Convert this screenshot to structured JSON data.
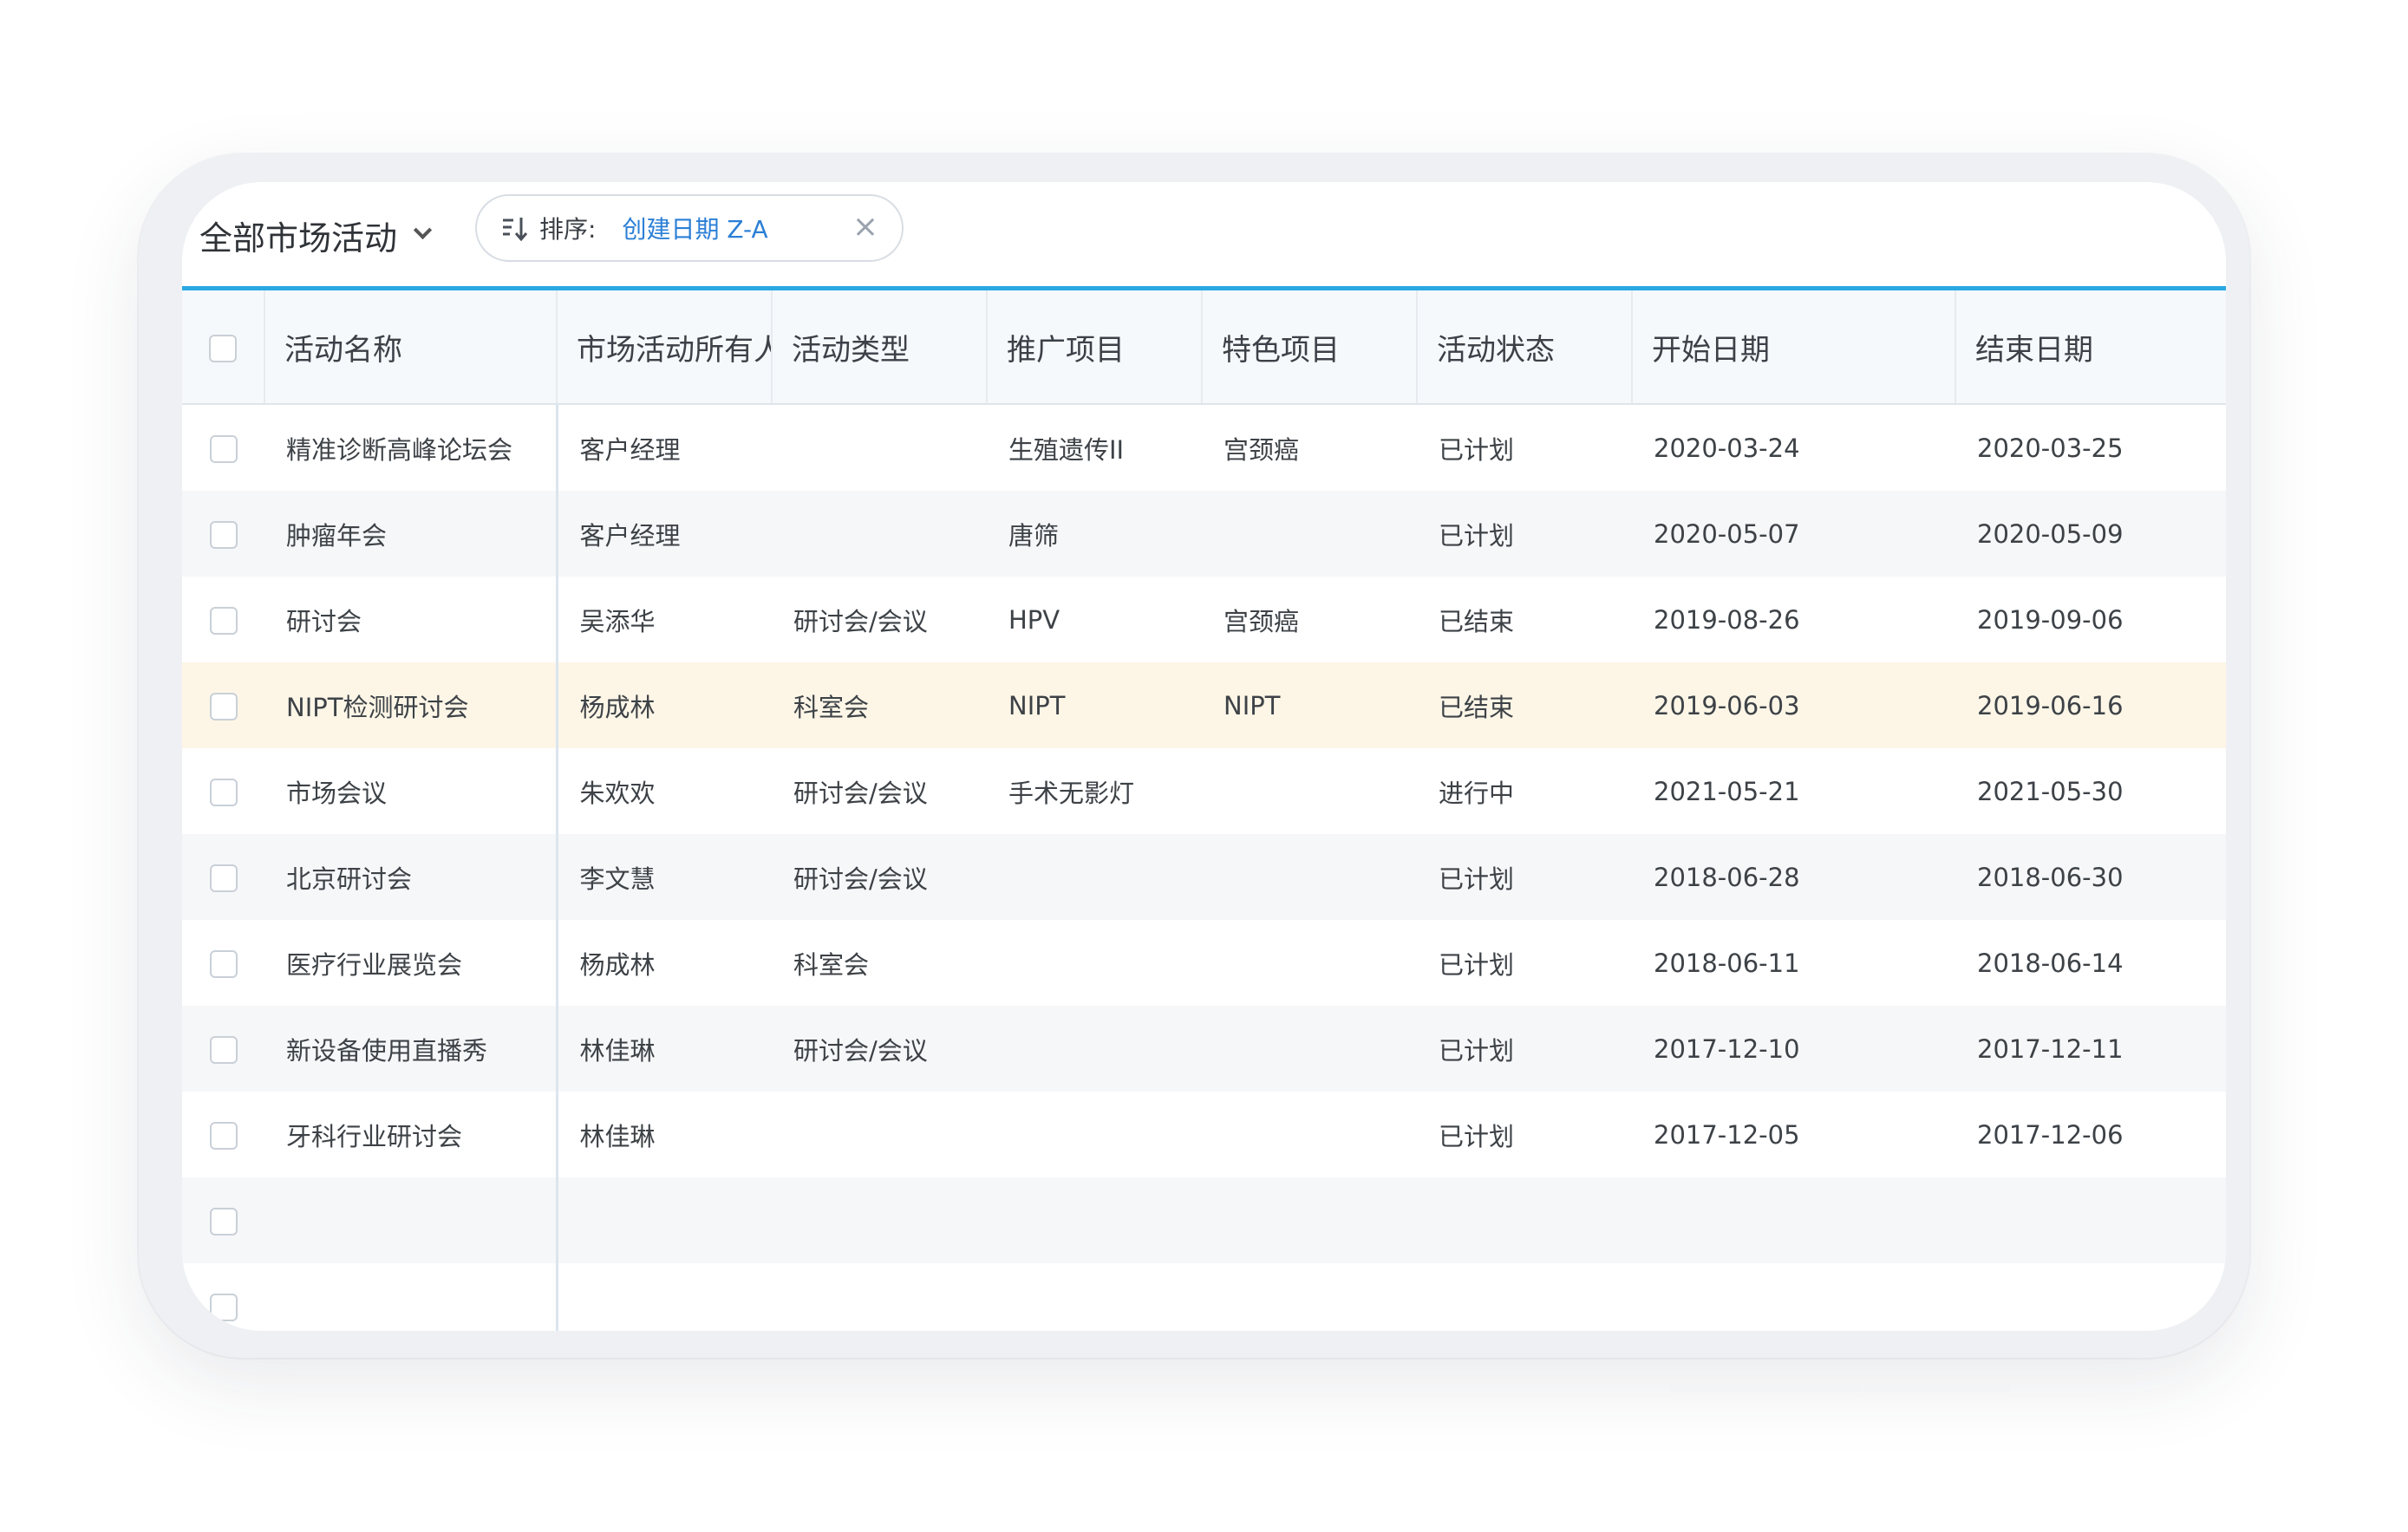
{
  "toolbar": {
    "view_title": "全部市场活动",
    "sort_label": "排序:",
    "sort_value": "创建日期 Z-A",
    "close_symbol": "×"
  },
  "columns": [
    "活动名称",
    "市场活动所有人",
    "活动类型",
    "推广项目",
    "特色项目",
    "活动状态",
    "开始日期",
    "结束日期"
  ],
  "rows": [
    {
      "name": "精准诊断高峰论坛会",
      "owner": "客户经理",
      "type": "",
      "promo": "生殖遗传II",
      "feature": "宫颈癌",
      "status": "已计划",
      "start": "2020-03-24",
      "end": "2020-03-25"
    },
    {
      "name": "肿瘤年会",
      "owner": "客户经理",
      "type": "",
      "promo": "唐筛",
      "feature": "",
      "status": "已计划",
      "start": "2020-05-07",
      "end": "2020-05-09"
    },
    {
      "name": "研讨会",
      "owner": "吴添华",
      "type": "研讨会/会议",
      "promo": "HPV",
      "feature": "宫颈癌",
      "status": "已结束",
      "start": "2019-08-26",
      "end": "2019-09-06"
    },
    {
      "name": "NIPT检测研讨会",
      "owner": "杨成林",
      "type": "科室会",
      "promo": "NIPT",
      "feature": "NIPT",
      "status": "已结束",
      "start": "2019-06-03",
      "end": "2019-06-16"
    },
    {
      "name": "市场会议",
      "owner": "朱欢欢",
      "type": "研讨会/会议",
      "promo": "手术无影灯",
      "feature": "",
      "status": "进行中",
      "start": "2021-05-21",
      "end": "2021-05-30"
    },
    {
      "name": "北京研讨会",
      "owner": "李文慧",
      "type": "研讨会/会议",
      "promo": "",
      "feature": "",
      "status": "已计划",
      "start": "2018-06-28",
      "end": "2018-06-30"
    },
    {
      "name": "医疗行业展览会",
      "owner": "杨成林",
      "type": "科室会",
      "promo": "",
      "feature": "",
      "status": "已计划",
      "start": "2018-06-11",
      "end": "2018-06-14"
    },
    {
      "name": "新设备使用直播秀",
      "owner": "林佳琳",
      "type": "研讨会/会议",
      "promo": "",
      "feature": "",
      "status": "已计划",
      "start": "2017-12-10",
      "end": "2017-12-11"
    },
    {
      "name": "牙科行业研讨会",
      "owner": "林佳琳",
      "type": "",
      "promo": "",
      "feature": "",
      "status": "已计划",
      "start": "2017-12-05",
      "end": "2017-12-06"
    }
  ],
  "highlight_row_index": 3,
  "colors": {
    "accent": "#2aa8e2",
    "link": "#2b8fcf",
    "highlight": "#fdf6e7"
  }
}
